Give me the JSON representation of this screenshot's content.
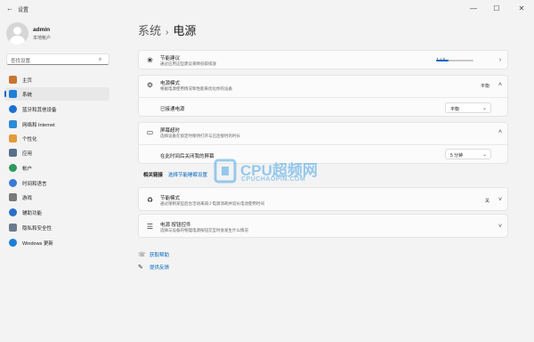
{
  "titlebar": {
    "title": "设置",
    "back": "←",
    "minimize": "—",
    "maximize": "☐",
    "close": "✕"
  },
  "profile": {
    "name": "admin",
    "account_type": "本地帐户"
  },
  "search": {
    "placeholder": "查找设置",
    "icon": "search-icon"
  },
  "sidebar": {
    "items": [
      {
        "label": "主页",
        "icon": "home-icon",
        "color": "#c9742f"
      },
      {
        "label": "系统",
        "icon": "system-icon",
        "color": "#1f7fd6",
        "active": true
      },
      {
        "label": "蓝牙和其他设备",
        "icon": "bluetooth-icon",
        "color": "#1e6fd1"
      },
      {
        "label": "网络和 Internet",
        "icon": "wifi-icon",
        "color": "#2c8bd8"
      },
      {
        "label": "个性化",
        "icon": "brush-icon",
        "color": "#e39b3b"
      },
      {
        "label": "应用",
        "icon": "apps-icon",
        "color": "#5a6f8a"
      },
      {
        "label": "帐户",
        "icon": "person-icon",
        "color": "#2c9a5c"
      },
      {
        "label": "时间和语言",
        "icon": "globe-clock-icon",
        "color": "#3a7bd5"
      },
      {
        "label": "游戏",
        "icon": "gamepad-icon",
        "color": "#7a7a7a"
      },
      {
        "label": "辅助功能",
        "icon": "accessibility-icon",
        "color": "#2a6fc9"
      },
      {
        "label": "隐私和安全性",
        "icon": "shield-icon",
        "color": "#6b7b8c"
      },
      {
        "label": "Windows 更新",
        "icon": "update-icon",
        "color": "#1f7fd6"
      }
    ]
  },
  "header": {
    "parent": "系统",
    "separator": "›",
    "current": "电源"
  },
  "cards": {
    "energy": {
      "title": "节能建议",
      "subtitle": "通过应用这些建议来降低碳排放",
      "progress_text": "1 / 3",
      "progress_fraction": 0.333
    },
    "power_mode": {
      "title": "电源模式",
      "subtitle": "根据电源使用情况和性能来优化你的设备",
      "value": "平衡",
      "row_label": "已接通电源",
      "select_value": "平衡"
    },
    "screen_sleep": {
      "title": "屏幕超时",
      "subtitle": "选择设备在锁定时保持打开与已连接时的时长",
      "row_label": "在此时间后关闭我的屏幕",
      "select_value": "5 分钟"
    },
    "related": {
      "label": "相关链接",
      "link": "选择节能睡眠设置"
    },
    "saver": {
      "title": "节能模式",
      "subtitle": "通过限制某些后台活动来减少电源消耗并延长电池使用时间",
      "value": "关"
    },
    "lid": {
      "title": "电源 按钮控件",
      "subtitle": "选择与设备的物理电源按钮交互时会发生什么情况"
    }
  },
  "help": {
    "get_help": "获取帮助",
    "feedback": "提供反馈"
  },
  "watermark": {
    "main": "CPU超频网",
    "sub": "CPUCHAOPIN.COM"
  }
}
